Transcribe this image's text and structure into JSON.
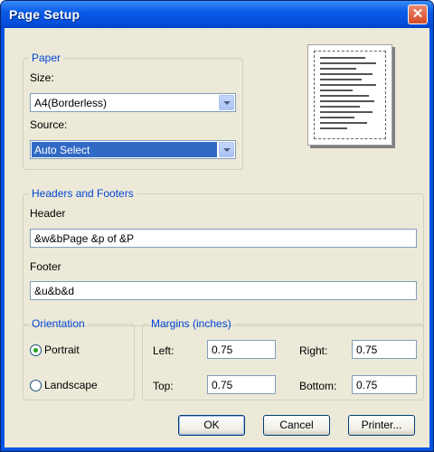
{
  "dialog": {
    "title": "Page Setup",
    "close_glyph": "✕"
  },
  "paper": {
    "legend": "Paper",
    "size_label": "Size:",
    "size_value": "A4(Borderless)",
    "source_label": "Source:",
    "source_value": "Auto Select"
  },
  "headers_footers": {
    "legend": "Headers and Footers",
    "header_label": "Header",
    "header_value": "&w&bPage &p of &P",
    "footer_label": "Footer",
    "footer_value": "&u&b&d"
  },
  "orientation": {
    "legend": "Orientation",
    "portrait_label": "Portrait",
    "landscape_label": "Landscape",
    "selected": "portrait"
  },
  "margins": {
    "legend": "Margins (inches)",
    "left_label": "Left:",
    "left_value": "0.75",
    "right_label": "Right:",
    "right_value": "0.75",
    "top_label": "Top:",
    "top_value": "0.75",
    "bottom_label": "Bottom:",
    "bottom_value": "0.75"
  },
  "buttons": {
    "ok": "OK",
    "cancel": "Cancel",
    "printer": "Printer..."
  },
  "colors": {
    "title_bar": "#0054E3",
    "dialog_bg": "#ECE9D8",
    "group_label": "#0046D5",
    "selection": "#316AC5"
  },
  "icons": {
    "close": "close-icon",
    "dropdown": "chevron-down-icon"
  }
}
